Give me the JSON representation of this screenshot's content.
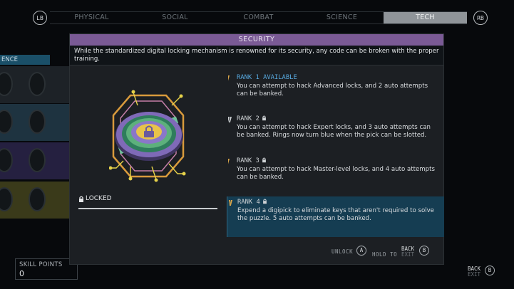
{
  "top_bar": {
    "left_bumper": "LB",
    "right_bumper": "RB",
    "tabs": [
      "PHYSICAL",
      "SOCIAL",
      "COMBAT",
      "SCIENCE",
      "TECH"
    ],
    "active_tab": "TECH"
  },
  "background": {
    "category_label": "ENCE",
    "row_colors": [
      "#1d2227",
      "#1e3340",
      "#252040",
      "#3a3a1a",
      "#252b30"
    ],
    "skill_points_label": "SKILL POINTS",
    "skill_points_value": "0"
  },
  "modal": {
    "title": "SECURITY",
    "title_color": "#7a5a95",
    "description": "While the standardized digital locking mechanism is renowned for its security, any code can be broken with the proper training.",
    "status_label": "LOCKED",
    "status_icon": "padlock-icon",
    "ranks": [
      {
        "heading": "RANK 1 AVAILABLE",
        "description": "You can attempt to hack Advanced locks, and 2 auto attempts can be banked.",
        "state": "available",
        "highlighted": false,
        "bar_color": "#d8a54a"
      },
      {
        "heading": "RANK 2",
        "description": "You can attempt to hack Expert locks, and 3 auto attempts can be banked. Rings now turn blue when the pick can be slotted.",
        "state": "locked",
        "highlighted": false,
        "bar_color": "#c9cdd0"
      },
      {
        "heading": "RANK 3",
        "description": "You can attempt to hack Master-level locks, and 4 auto attempts can be banked.",
        "state": "locked",
        "highlighted": false,
        "bar_color": "#d8a54a"
      },
      {
        "heading": "RANK 4",
        "description": "Expend a digipick to eliminate keys that aren't required to solve the puzzle. 5 auto attempts can be banked.",
        "state": "locked",
        "highlighted": true,
        "bar_color": "#d8a54a"
      }
    ],
    "footer": {
      "unlock_label": "UNLOCK",
      "unlock_key": "A",
      "hold_label": "HOLD TO",
      "back_label": "BACK",
      "exit_label": "EXIT",
      "back_key": "B"
    }
  },
  "corner_hint": {
    "back_label": "BACK",
    "exit_label": "EXIT",
    "key": "B"
  }
}
